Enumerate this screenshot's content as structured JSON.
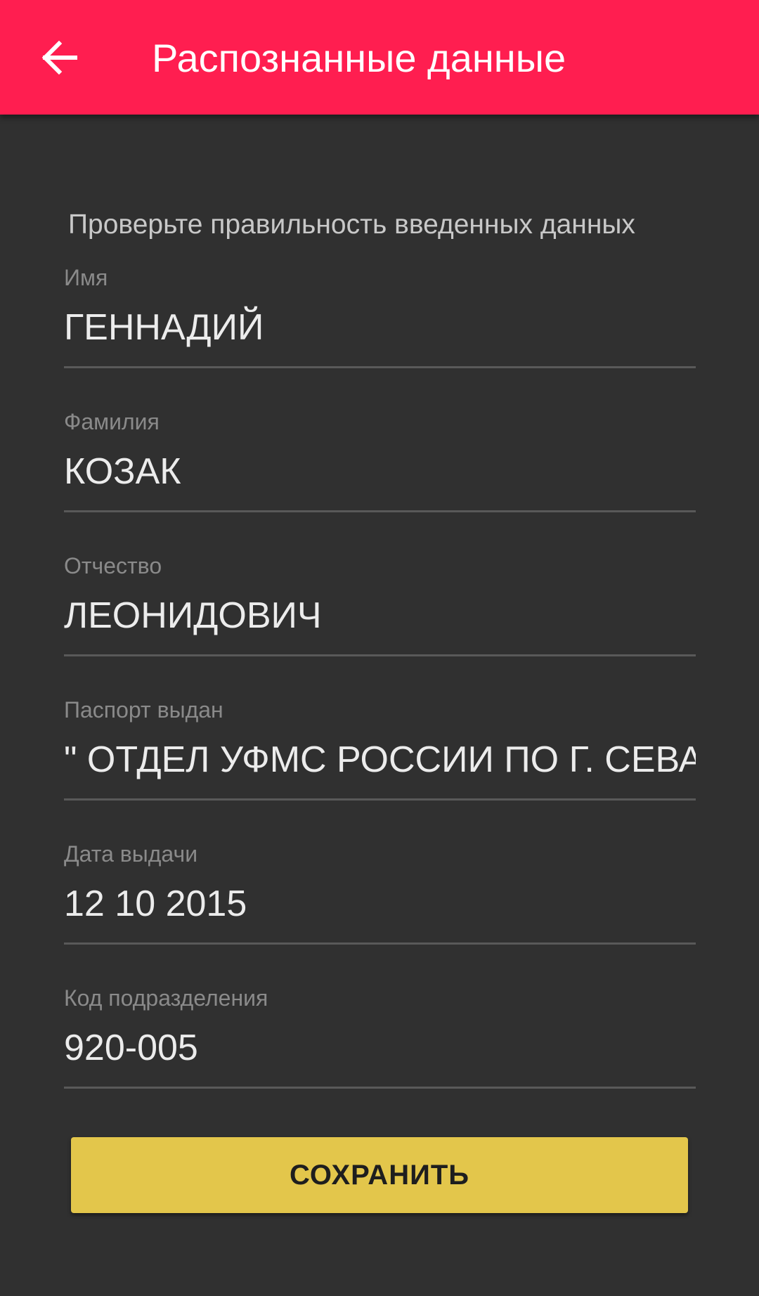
{
  "app_bar": {
    "title": "Распознанные данные",
    "back_icon": "arrow-left-icon",
    "background_color": "#ff1e50"
  },
  "form": {
    "subtitle": "Проверьте правильность введенных данных",
    "fields": [
      {
        "label": "Имя",
        "value": "ГЕННАДИЙ"
      },
      {
        "label": "Фамилия",
        "value": "КОЗАК"
      },
      {
        "label": "Отчество",
        "value": "ЛЕОНИДОВИЧ"
      },
      {
        "label": "Паспорт выдан",
        "value": "\" ОТДЕЛ УФМС РОССИИ ПО Г. СЕВАС"
      },
      {
        "label": "Дата выдачи",
        "value": "12 10 2015"
      },
      {
        "label": "Код подразделения",
        "value": "920-005"
      }
    ]
  },
  "actions": {
    "save_label": "СОХРАНИТЬ",
    "save_color": "#e3c64b"
  }
}
